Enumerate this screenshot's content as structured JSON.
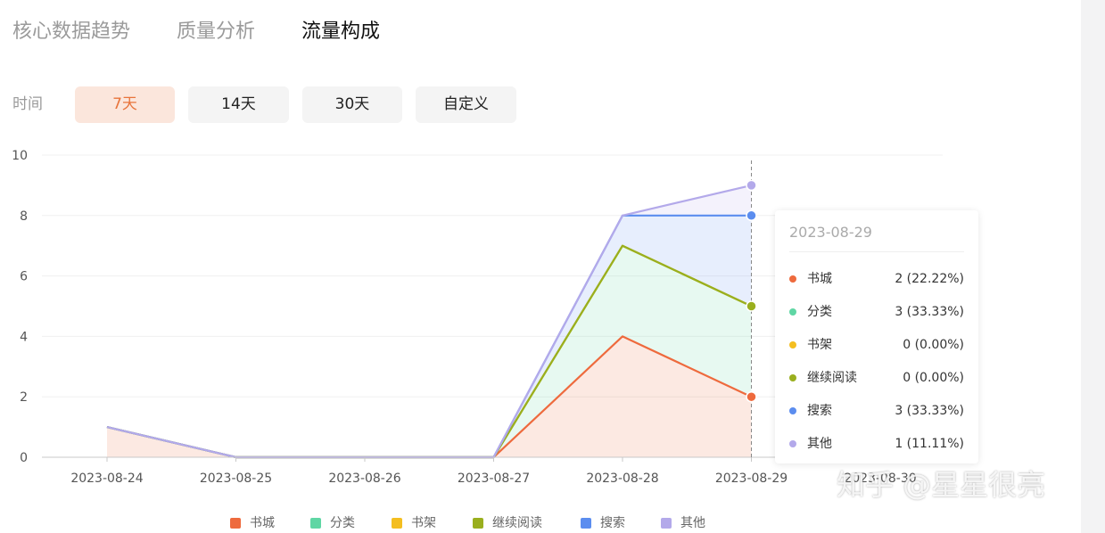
{
  "tabs": [
    {
      "label": "核心数据趋势",
      "active": false
    },
    {
      "label": "质量分析",
      "active": false
    },
    {
      "label": "流量构成",
      "active": true
    }
  ],
  "time_filter": {
    "label": "时间",
    "options": [
      "7天",
      "14天",
      "30天",
      "自定义"
    ],
    "selected": "7天"
  },
  "colors": {
    "accent": "#e8743b",
    "书城": "#ee6a3d",
    "分类": "#5fd6a4",
    "书架": "#f4be20",
    "继续阅读": "#9aaf1e",
    "搜索": "#5b8def",
    "其他": "#b3a9ea"
  },
  "chart_data": {
    "type": "area",
    "stacked": true,
    "x": [
      "2023-08-24",
      "2023-08-25",
      "2023-08-26",
      "2023-08-27",
      "2023-08-28",
      "2023-08-29",
      "2023-08-30"
    ],
    "ylim": [
      0,
      10
    ],
    "yticks": [
      0,
      2,
      4,
      6,
      8,
      10
    ],
    "grid": true,
    "legend_position": "bottom-center",
    "series": [
      {
        "name": "书城",
        "values": [
          1,
          0,
          0,
          0,
          4,
          2
        ]
      },
      {
        "name": "分类",
        "values": [
          0,
          0,
          0,
          0,
          3,
          3
        ]
      },
      {
        "name": "书架",
        "values": [
          0,
          0,
          0,
          0,
          0,
          0
        ]
      },
      {
        "name": "继续阅读",
        "values": [
          0,
          0,
          0,
          0,
          0,
          0
        ]
      },
      {
        "name": "搜索",
        "values": [
          0,
          0,
          0,
          0,
          1,
          3
        ]
      },
      {
        "name": "其他",
        "values": [
          0,
          0,
          0,
          0,
          0,
          1
        ]
      }
    ],
    "highlight_x": "2023-08-29"
  },
  "tooltip": {
    "date": "2023-08-29",
    "rows": [
      {
        "name": "书城",
        "value": "2 (22.22%)"
      },
      {
        "name": "分类",
        "value": "3 (33.33%)"
      },
      {
        "name": "书架",
        "value": "0 (0.00%)"
      },
      {
        "name": "继续阅读",
        "value": "0 (0.00%)"
      },
      {
        "name": "搜索",
        "value": "3 (33.33%)"
      },
      {
        "name": "其他",
        "value": "1 (11.11%)"
      }
    ]
  },
  "watermark": "知乎 @星星很亮"
}
